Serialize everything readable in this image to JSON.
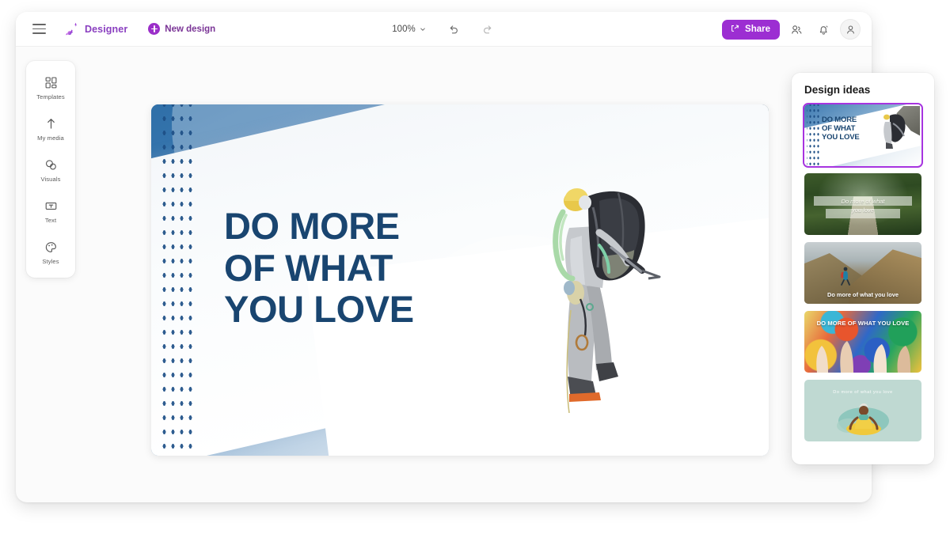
{
  "toolbar": {
    "menu_icon": "hamburger-menu-icon",
    "brand_name": "Designer",
    "brand_logo_icon": "designer-logo-icon",
    "new_design_label": "New design",
    "new_design_icon": "plus-circle-icon",
    "zoom_level": "100%",
    "zoom_chevron_icon": "chevron-down-icon",
    "undo_icon": "undo-arrow-icon",
    "redo_icon": "redo-arrow-icon",
    "share_label": "Share",
    "share_icon": "share-icon",
    "collaborate_icon": "collaborate-people-icon",
    "notifications_icon": "bell-icon",
    "account_icon": "account-avatar-icon",
    "share_color": "#9c2ed2",
    "brand_color": "#8a3fc0"
  },
  "tool_rail": {
    "items": [
      {
        "label": "Templates",
        "icon": "templates-grid-icon"
      },
      {
        "label": "My media",
        "icon": "upload-arrow-icon"
      },
      {
        "label": "Visuals",
        "icon": "visuals-shapes-icon"
      },
      {
        "label": "Text",
        "icon": "text-box-icon"
      },
      {
        "label": "Styles",
        "icon": "styles-palette-icon"
      }
    ]
  },
  "canvas": {
    "headline": "DO MORE\nOF WHAT\nYOU LOVE",
    "headline_color": "#194570",
    "background_description": "mountaineer-climbing-snow-slope-photo",
    "dot_pattern": "navy-dot-grid-overlay"
  },
  "design_ideas": {
    "title": "Design ideas",
    "selected_index": 0,
    "selection_color": "#a734e0",
    "items": [
      {
        "name": "snow-climber-design",
        "caption": "DO MORE\nOF WHAT\nYOU LOVE",
        "style": "t1"
      },
      {
        "name": "forest-bridge-design",
        "caption": "Do more of what\nyou love",
        "style": "t2"
      },
      {
        "name": "mountain-hiker-design",
        "caption": "Do more of what you love",
        "style": "t3"
      },
      {
        "name": "colorful-paint-design",
        "caption": "DO MORE OF WHAT YOU LOVE",
        "style": "t4"
      },
      {
        "name": "teal-yoga-design",
        "caption": "Do more of what you love",
        "style": "t5"
      }
    ]
  }
}
